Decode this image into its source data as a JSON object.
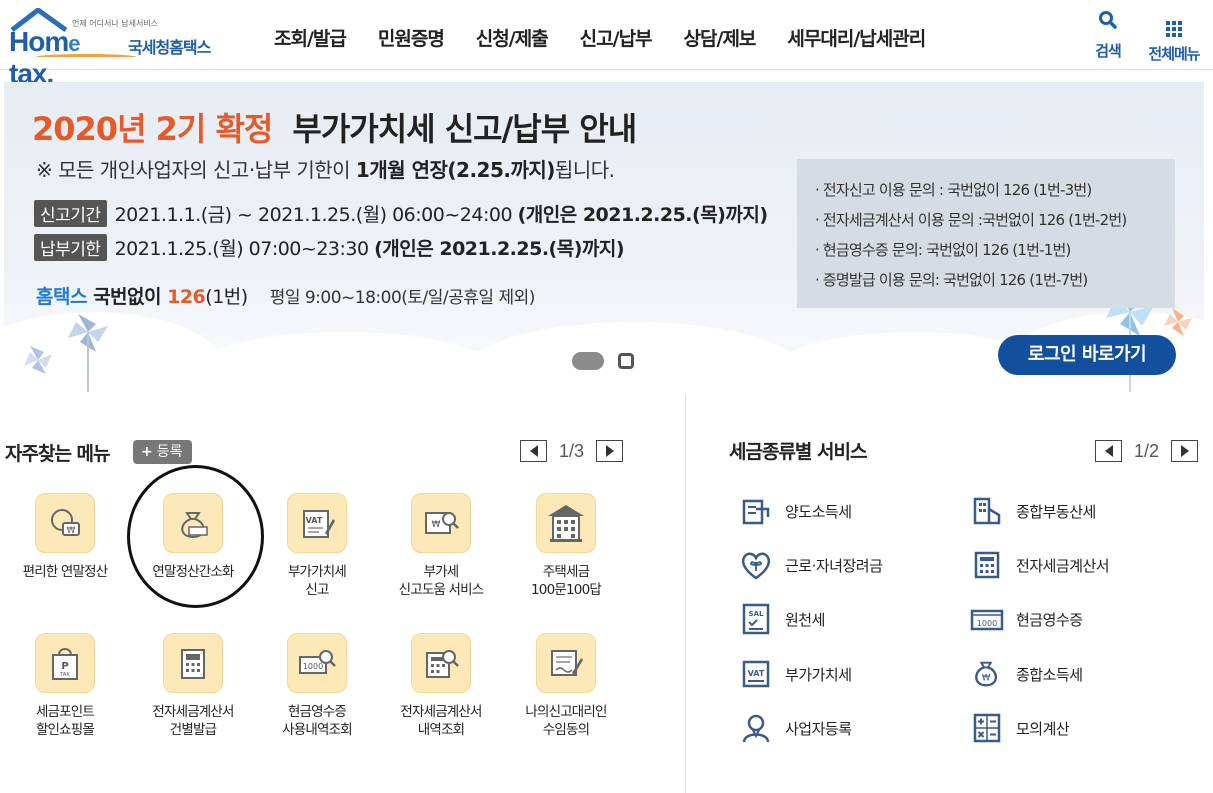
{
  "header": {
    "logo_tagline": "언제 어디서나 납세서비스",
    "logo_brand_home": "Hom",
    "logo_brand_e": "e",
    "logo_brand_tax": "tax.",
    "logo_sub": "국세청홈택스",
    "nav": [
      "조회/발급",
      "민원증명",
      "신청/제출",
      "신고/납부",
      "상담/제보",
      "세무대리/납세관리"
    ],
    "search_label": "검색",
    "allmenu_label": "전체메뉴"
  },
  "banner": {
    "title_highlight": "2020년 2기 확정",
    "title_rest": "부가가치세 신고/납부 안내",
    "notice_prefix": "※ 모든 개인사업자의 신고·납부 기한이 ",
    "notice_bold": "1개월 연장(2.25.까지)",
    "notice_suffix": "됩니다.",
    "row1_tag": "신고기간",
    "row1_text": "2021.1.1.(금) ~ 2021.1.25.(월) 06:00~24:00 ",
    "row1_bold": "(개인은 2021.2.25.(목)까지)",
    "row2_tag": "납부기한",
    "row2_text": "2021.1.25.(월) 07:00~23:30 ",
    "row2_bold": "(개인은 2021.2.25.(목)까지)",
    "contact_brand": "홈택스",
    "contact_text": " 국번없이 ",
    "contact_num": "126",
    "contact_suffix": "(1번)",
    "contact_hours": "평일 9:00~18:00(토/일/공휴일 제외)",
    "box_lines": [
      "· 전자신고 이용 문의 : 국번없이 126 (1번-3번)",
      "· 전자세금계산서 이용 문의 :국번없이 126 (1번-2번)",
      "· 현금영수증 문의: 국번없이 126 (1번-1번)",
      "· 증명발급 이용 문의: 국번없이 126 (1번-7번)"
    ],
    "login_button": "로그인 바로가기"
  },
  "favorites": {
    "title": "자주찾는 메뉴",
    "register_plus": "+",
    "register_label": "등록",
    "page": "1/3",
    "items": [
      {
        "label": "편리한 연말정산",
        "icon": "coin-won-icon"
      },
      {
        "label": "연말정산간소화",
        "icon": "money-bag-icon"
      },
      {
        "label": "부가가치세\n신고",
        "icon": "vat-document-icon"
      },
      {
        "label": "부가세\n신고도움 서비스",
        "icon": "won-search-icon"
      },
      {
        "label": "주택세금\n100문100답",
        "icon": "building-icon"
      },
      {
        "label": "세금포인트\n할인쇼핑몰",
        "icon": "shopping-bag-icon"
      },
      {
        "label": "전자세금계산서\n건별발급",
        "icon": "calculator-doc-icon"
      },
      {
        "label": "현금영수증\n사용내역조회",
        "icon": "receipt-search-icon"
      },
      {
        "label": "전자세금계산서\n내역조회",
        "icon": "invoice-search-icon"
      },
      {
        "label": "나의신고대리인\n수임동의",
        "icon": "pen-document-icon"
      }
    ]
  },
  "tax_services": {
    "title": "세금종류별 서비스",
    "page": "1/2",
    "items": [
      {
        "label": "양도소득세",
        "icon": "transfer-doc-icon"
      },
      {
        "label": "종합부동산세",
        "icon": "real-estate-icon"
      },
      {
        "label": "근로·자녀장려금",
        "icon": "heart-sprout-icon"
      },
      {
        "label": "전자세금계산서",
        "icon": "e-invoice-icon"
      },
      {
        "label": "원천세",
        "icon": "sal-document-icon"
      },
      {
        "label": "현금영수증",
        "icon": "cash-receipt-icon"
      },
      {
        "label": "부가가치세",
        "icon": "vat-icon"
      },
      {
        "label": "종합소득세",
        "icon": "won-bag-icon"
      },
      {
        "label": "사업자등록",
        "icon": "person-icon"
      },
      {
        "label": "모의계산",
        "icon": "calculator-icon"
      }
    ]
  },
  "colors": {
    "brand_blue": "#1f5ea8",
    "accent_orange": "#e55a2b",
    "login_button": "#12509e",
    "fav_icon_bg": "#fde9b8"
  }
}
